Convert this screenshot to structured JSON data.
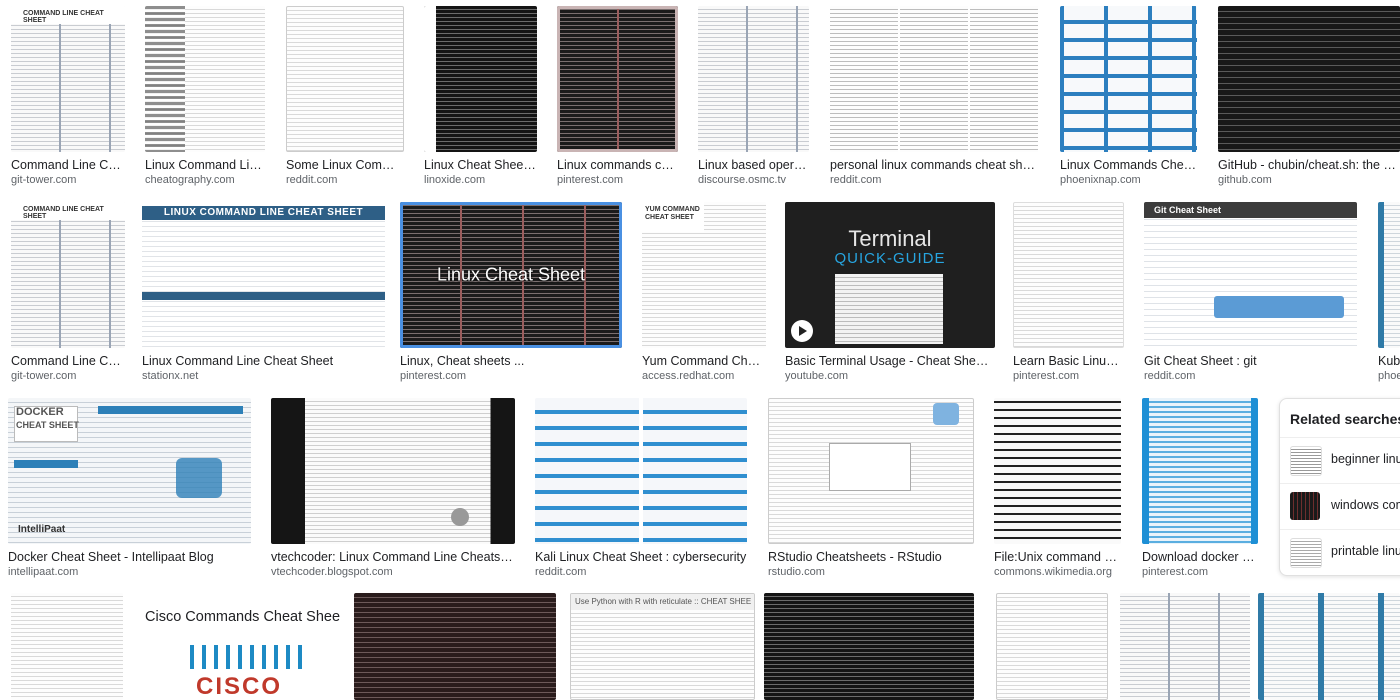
{
  "results": {
    "row1": [
      {
        "title": "Command Line Cheat ...",
        "source": "git-tower.com"
      },
      {
        "title": "Linux Command Line Ch...",
        "source": "cheatography.com"
      },
      {
        "title": "Some Linux Commands...",
        "source": "reddit.com"
      },
      {
        "title": "Linux Cheat Sheet Com...",
        "source": "linoxide.com"
      },
      {
        "title": "Linux commands cheat ...",
        "source": "pinterest.com"
      },
      {
        "title": "Linux based operating ...",
        "source": "discourse.osmc.tv"
      },
      {
        "title": "personal linux commands cheat sheet ...",
        "source": "reddit.com"
      },
      {
        "title": "Linux Commands Cheat She...",
        "source": "phoenixnap.com"
      },
      {
        "title": "GitHub - chubin/cheat.sh: the only ...",
        "source": "github.com"
      }
    ],
    "row2": [
      {
        "title": "Command Line Cheat ...",
        "source": "git-tower.com"
      },
      {
        "title": "Linux Command Line Cheat Sheet",
        "source": "stationx.net"
      },
      {
        "title": "Linux, Cheat sheets ...",
        "source": "pinterest.com",
        "overlay": "Linux Cheat Sheet"
      },
      {
        "title": "Yum Command Cheat Sh...",
        "source": "access.redhat.com"
      },
      {
        "title": "Basic Terminal Usage - Cheat Sheet to ...",
        "source": "youtube.com"
      },
      {
        "title": "Learn Basic Linux Com...",
        "source": "pinterest.com"
      },
      {
        "title": "Git Cheat Sheet : git",
        "source": "reddit.com"
      },
      {
        "title": "Kube",
        "source": "phoe"
      }
    ],
    "row3": [
      {
        "title": "Docker Cheat Sheet - Intellipaat Blog",
        "source": "intellipaat.com"
      },
      {
        "title": "vtechcoder: Linux Command Line Cheatsheet",
        "source": "vtechcoder.blogspot.com"
      },
      {
        "title": "Kali Linux Cheat Sheet : cybersecurity",
        "source": "reddit.com"
      },
      {
        "title": "RStudio Cheatsheets - RStudio",
        "source": "rstudio.com"
      },
      {
        "title": "File:Unix command cheats...",
        "source": "commons.wikimedia.org"
      },
      {
        "title": "Download docker comm...",
        "source": "pinterest.com"
      }
    ]
  },
  "thumb_text": {
    "tower_heading": "COMMAND LINE CHEAT SHEET",
    "stationx_heading": "LINUX COMMAND LINE CHEAT SHEET",
    "terminal_line1": "Terminal",
    "terminal_line2": "QUICK-GUIDE",
    "docker_heading1": "DOCKER",
    "docker_heading2": "CHEAT SHEET",
    "intellipaat": "IntelliPaat",
    "cisco_heading": "Cisco Commands Cheat Sheet",
    "cisco_logo": "CISCO",
    "reticulate": "Use Python with R with reticulate :: CHEAT SHEET",
    "yum_heading": "YUM COMMAND CHEAT SHEET",
    "git_heading": "Git Cheat Sheet"
  },
  "related": {
    "heading": "Related searches",
    "items": [
      "beginner linux",
      "windows com",
      "printable linux"
    ]
  },
  "colors": {
    "accent_selected": "#4a90e2",
    "caption": "#202124",
    "source": "#5f6368"
  }
}
